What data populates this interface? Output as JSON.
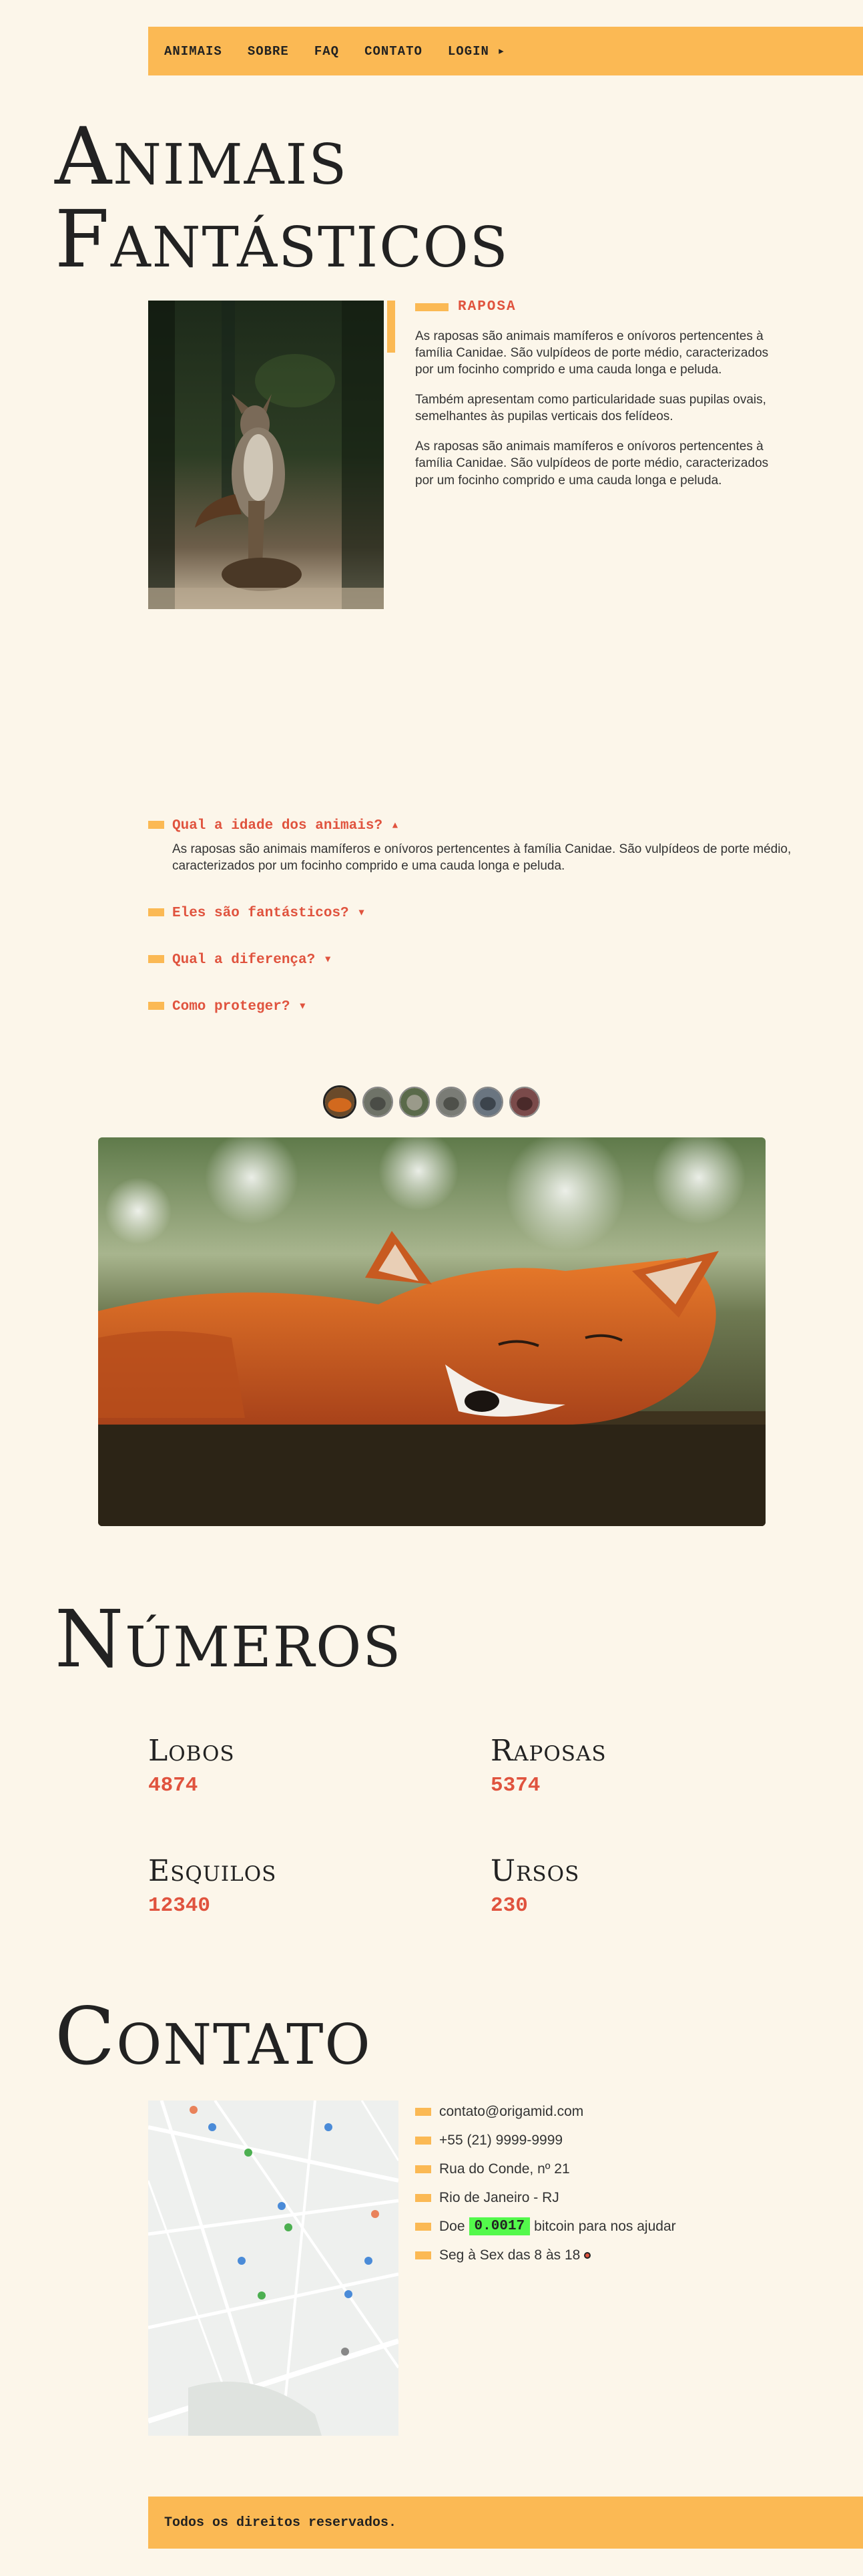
{
  "nav": {
    "items": [
      "ANIMAIS",
      "SOBRE",
      "FAQ",
      "CONTATO",
      "LOGIN ▸"
    ]
  },
  "animais": {
    "title_line1": "Animais",
    "title_line2": "Fantásticos",
    "active_label": "RAPOSA",
    "paragraphs": [
      "As raposas são animais mamíferos e onívoros pertencentes à família Canidae. São vulpídeos de porte médio, caracterizados por um focinho comprido e uma cauda longa e peluda.",
      "Também apresentam como particularidade suas pupilas ovais, semelhantes às pupilas verticais dos felídeos.",
      "As raposas são animais mamíferos e onívoros pertencentes à família Canidae. São vulpídeos de porte médio, caracterizados por um focinho comprido e uma cauda longa e peluda."
    ]
  },
  "faq": {
    "items": [
      {
        "question": "Qual a idade dos animais? ▴",
        "answer": "As raposas são animais mamíferos e onívoros pertencentes à família Canidae. São vulpídeos de porte médio, caracterizados por um focinho comprido e uma cauda longa e peluda.",
        "open": true
      },
      {
        "question": "Eles são fantásticos? ▾",
        "answer": "",
        "open": false
      },
      {
        "question": "Qual a diferença? ▾",
        "answer": "",
        "open": false
      },
      {
        "question": "Como proteger? ▾",
        "answer": "",
        "open": false
      }
    ]
  },
  "numeros": {
    "title": "Números",
    "items": [
      {
        "name": "Lobos",
        "value": "4874"
      },
      {
        "name": "Raposas",
        "value": "5374"
      },
      {
        "name": "Esquilos",
        "value": "12340"
      },
      {
        "name": "Ursos",
        "value": "230"
      }
    ]
  },
  "contato": {
    "title": "Contato",
    "email": "contato@origamid.com",
    "phone": "+55 (21) 9999-9999",
    "address": "Rua do Conde, nº 21",
    "city": "Rio de Janeiro - RJ",
    "donate_prefix": "Doe",
    "btc_value": "0.0017",
    "donate_suffix": "bitcoin para nos ajudar",
    "hours": "Seg à Sex das 8 às 18"
  },
  "footer": {
    "text": "Todos os direitos reservados."
  },
  "colors": {
    "accent": "#fbb954",
    "highlight": "#e0533e",
    "background": "#fcf6ea",
    "btc": "#53f94b"
  }
}
